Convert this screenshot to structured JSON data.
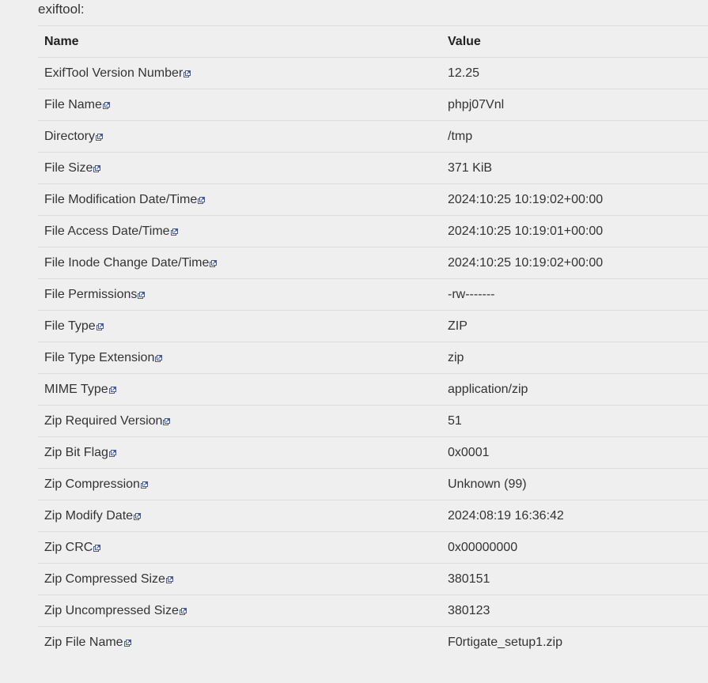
{
  "heading": "exiftool:",
  "table": {
    "headers": {
      "name": "Name",
      "value": "Value"
    },
    "rows": [
      {
        "name": "ExifTool Version Number",
        "value": "12.25",
        "icon": "external-link-icon"
      },
      {
        "name": "File Name",
        "value": "phpj07Vnl",
        "icon": "external-link-icon"
      },
      {
        "name": "Directory",
        "value": "/tmp",
        "icon": "external-link-icon"
      },
      {
        "name": "File Size",
        "value": "371 KiB",
        "icon": "external-link-icon"
      },
      {
        "name": "File Modification Date/Time",
        "value": "2024:10:25 10:19:02+00:00",
        "icon": "external-link-icon"
      },
      {
        "name": "File Access Date/Time",
        "value": "2024:10:25 10:19:01+00:00",
        "icon": "external-link-icon"
      },
      {
        "name": "File Inode Change Date/Time",
        "value": "2024:10:25 10:19:02+00:00",
        "icon": "external-link-icon"
      },
      {
        "name": "File Permissions",
        "value": "-rw-------",
        "icon": "external-link-icon"
      },
      {
        "name": "File Type",
        "value": "ZIP",
        "icon": "external-link-icon"
      },
      {
        "name": "File Type Extension",
        "value": "zip",
        "icon": "external-link-icon"
      },
      {
        "name": "MIME Type",
        "value": "application/zip",
        "icon": "external-link-icon"
      },
      {
        "name": "Zip Required Version",
        "value": "51",
        "icon": "external-link-icon"
      },
      {
        "name": "Zip Bit Flag",
        "value": "0x0001",
        "icon": "external-link-icon"
      },
      {
        "name": "Zip Compression",
        "value": "Unknown (99)",
        "icon": "external-link-icon"
      },
      {
        "name": "Zip Modify Date",
        "value": "2024:08:19 16:36:42",
        "icon": "external-link-icon"
      },
      {
        "name": "Zip CRC",
        "value": "0x00000000",
        "icon": "external-link-icon"
      },
      {
        "name": "Zip Compressed Size",
        "value": "380151",
        "icon": "external-link-icon"
      },
      {
        "name": "Zip Uncompressed Size",
        "value": "380123",
        "icon": "external-link-icon"
      },
      {
        "name": "Zip File Name",
        "value": "F0rtigate_setup1.zip",
        "icon": "external-link-icon"
      }
    ]
  },
  "colors": {
    "background": "#efefef",
    "border": "#dcdcdc",
    "link_icon": "#3b5bab"
  }
}
